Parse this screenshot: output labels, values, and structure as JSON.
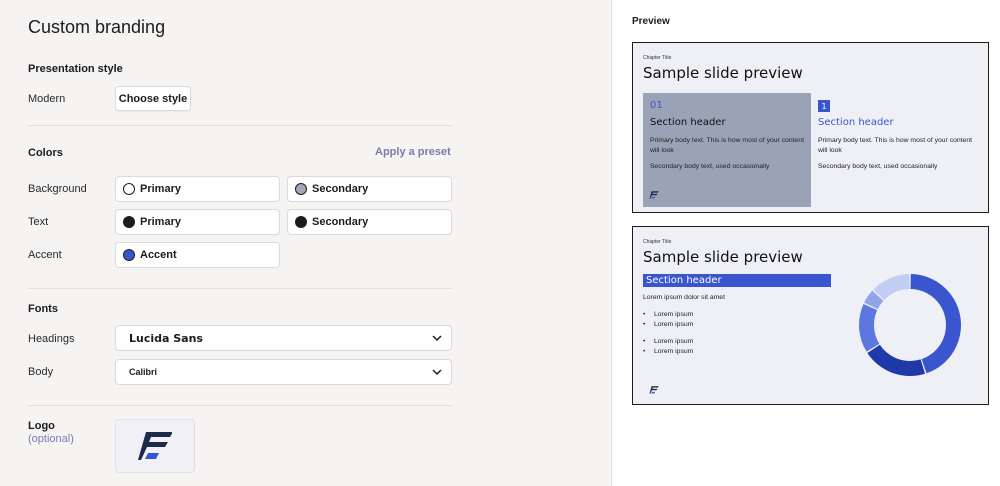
{
  "page": {
    "title": "Custom branding"
  },
  "presentation_style": {
    "section_title": "Presentation style",
    "row_label": "Modern",
    "button_label": "Choose style"
  },
  "colors": {
    "section_title": "Colors",
    "preset_link": "Apply a preset",
    "rows": {
      "background": {
        "label": "Background",
        "primary": "Primary",
        "secondary": "Secondary",
        "primary_color": "#ffffff",
        "secondary_color": "#a3a8b8"
      },
      "text": {
        "label": "Text",
        "primary": "Primary",
        "secondary": "Secondary",
        "primary_color": "#1c1c1e",
        "secondary_color": "#1c1c1e"
      },
      "accent": {
        "label": "Accent",
        "accent": "Accent",
        "accent_color": "#3a56cf"
      }
    }
  },
  "fonts": {
    "section_title": "Fonts",
    "headings": {
      "label": "Headings",
      "value": "Lucida Sans"
    },
    "body": {
      "label": "Body",
      "value": "Calibri"
    }
  },
  "logo": {
    "label": "Logo",
    "sublabel": "(optional)",
    "icon": "brand-f-logo-icon"
  },
  "preview": {
    "label": "Preview",
    "slide1": {
      "chapter": "Chapter Title",
      "title": "Sample slide preview",
      "left": {
        "number": "01",
        "header": "Section header",
        "primary": "Primary body text. This is how most of your content will look",
        "secondary": "Secondary body text, used occasionally"
      },
      "right": {
        "number": "1",
        "header": "Section header",
        "primary": "Primary body text. This is how most of your content will look",
        "secondary": "Secondary body text, used occasionally"
      }
    },
    "slide2": {
      "chapter": "Chapter Title",
      "title": "Sample slide preview",
      "header": "Section header",
      "lead": "Lorem ipsum dolor sit amet",
      "bullets_a": [
        "Lorem ipsum",
        "Lorem ipsum"
      ],
      "bullets_b": [
        "Lorem ipsum",
        "Lorem ipsum"
      ],
      "donut": [
        {
          "value": 45,
          "color": "#3a56cf"
        },
        {
          "value": 21,
          "color": "#1f3aa8"
        },
        {
          "value": 16,
          "color": "#5c78e0"
        },
        {
          "value": 5,
          "color": "#90a4ea"
        },
        {
          "value": 13,
          "color": "#c2cdf4"
        }
      ]
    }
  }
}
